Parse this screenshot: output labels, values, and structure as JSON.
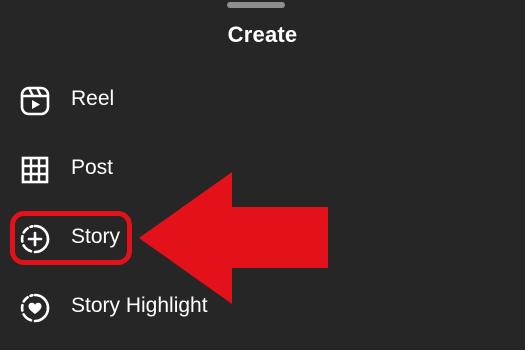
{
  "sheet": {
    "title": "Create",
    "items": [
      {
        "label": "Reel",
        "icon": "reel-icon"
      },
      {
        "label": "Post",
        "icon": "grid-icon"
      },
      {
        "label": "Story",
        "icon": "story-add-icon"
      },
      {
        "label": "Story Highlight",
        "icon": "story-highlight-icon"
      }
    ]
  },
  "annotation": {
    "highlighted_item": "Story",
    "color": "#e3121a"
  },
  "colors": {
    "background": "#262626",
    "text": "#ffffff",
    "handle": "#8e8e8e"
  }
}
